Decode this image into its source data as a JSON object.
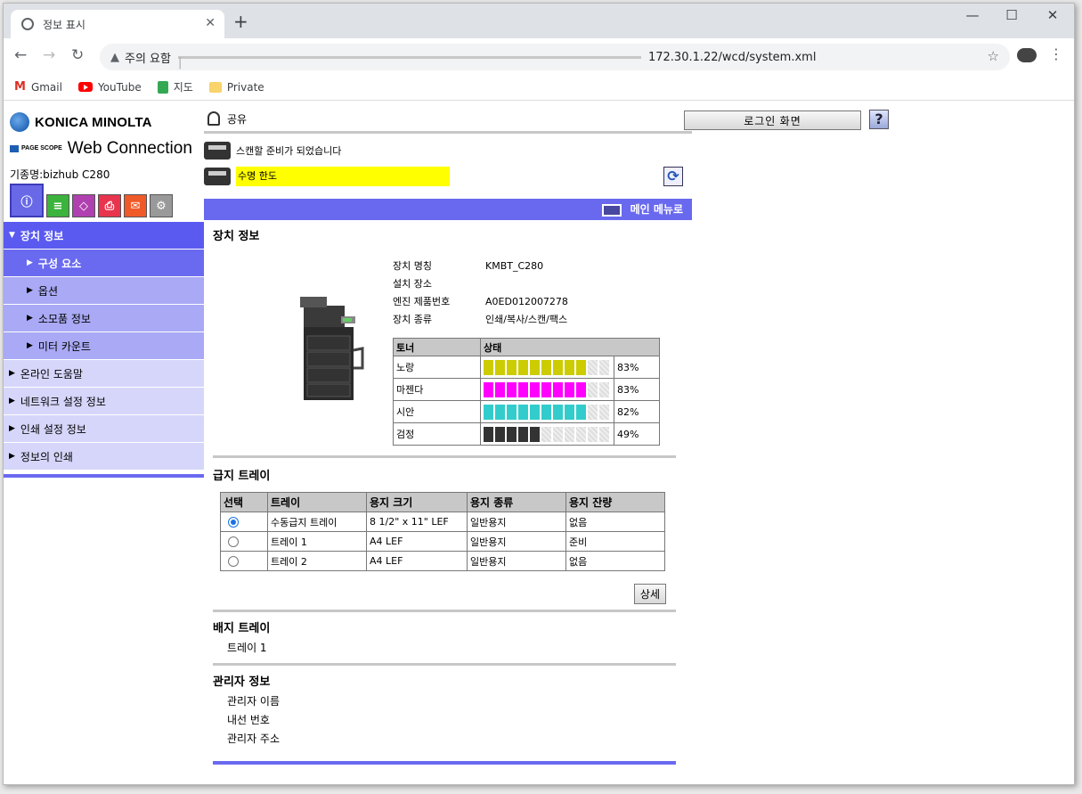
{
  "browser": {
    "tab_title": "정보 표시",
    "url_warning": "주의 요함",
    "url": "172.30.1.22/wcd/system.xml",
    "bookmarks": [
      {
        "label": "Gmail",
        "icon": "gmail-icon"
      },
      {
        "label": "YouTube",
        "icon": "youtube-icon"
      },
      {
        "label": "지도",
        "icon": "maps-icon"
      },
      {
        "label": "Private",
        "icon": "folder-icon"
      }
    ]
  },
  "header": {
    "brand": "KONICA MINOLTA",
    "product_prefix": "PAGE SCOPE",
    "product": "Web Connection",
    "model": "기종명:bizhub C280",
    "user": "공유",
    "login_label": "로그인 화면",
    "help_label": "?",
    "status_scan": "스캔할 준비가 되었습니다",
    "status_warning": "수명 한도",
    "main_menu_label": "메인 메뉴로"
  },
  "sidebar": {
    "items": [
      {
        "label": "장치 정보",
        "level": 0
      },
      {
        "label": "구성 요소",
        "level": 1,
        "active": true
      },
      {
        "label": "옵션",
        "level": 1
      },
      {
        "label": "소모품 정보",
        "level": 1
      },
      {
        "label": "미터 카운트",
        "level": 1
      },
      {
        "label": "온라인 도움말",
        "level": 2
      },
      {
        "label": "네트워크 설정 정보",
        "level": 2
      },
      {
        "label": "인쇄 설정 정보",
        "level": 2
      },
      {
        "label": "정보의 인쇄",
        "level": 2
      }
    ]
  },
  "device": {
    "section_title": "장치 정보",
    "fields": [
      {
        "key": "장치 명칭",
        "value": "KMBT_C280"
      },
      {
        "key": "설치 장소",
        "value": ""
      },
      {
        "key": "엔진 제품번호",
        "value": "A0ED012007278"
      },
      {
        "key": "장치 종류",
        "value": "인쇄/복사/스캔/팩스"
      }
    ],
    "toner_headers": [
      "토너",
      "상태"
    ],
    "toner": [
      {
        "name": "노랑",
        "percent": "83%",
        "level": 0.83,
        "color": "#cccc00"
      },
      {
        "name": "마젠다",
        "percent": "83%",
        "level": 0.83,
        "color": "#ff00ff"
      },
      {
        "name": "시안",
        "percent": "82%",
        "level": 0.82,
        "color": "#33cccc"
      },
      {
        "name": "검정",
        "percent": "49%",
        "level": 0.49,
        "color": "#333333"
      }
    ]
  },
  "paper": {
    "section_title": "급지 트레이",
    "headers": [
      "선택",
      "트레이",
      "용지 크기",
      "용지 종류",
      "용지 잔량"
    ],
    "rows": [
      {
        "selected": true,
        "tray": "수동급지 트레이",
        "size": "8 1/2\" x 11\" LEF",
        "type": "일반용지",
        "remain": "없음"
      },
      {
        "selected": false,
        "tray": "트레이 1",
        "size": "A4 LEF",
        "type": "일반용지",
        "remain": "준비"
      },
      {
        "selected": false,
        "tray": "트레이 2",
        "size": "A4 LEF",
        "type": "일반용지",
        "remain": "없음"
      }
    ],
    "detail_label": "상세"
  },
  "output": {
    "section_title": "배지 트레이",
    "tray": "트레이 1"
  },
  "admin": {
    "section_title": "관리자 정보",
    "fields": [
      "관리자 이름",
      "내선 번호",
      "관리자 주소"
    ]
  }
}
